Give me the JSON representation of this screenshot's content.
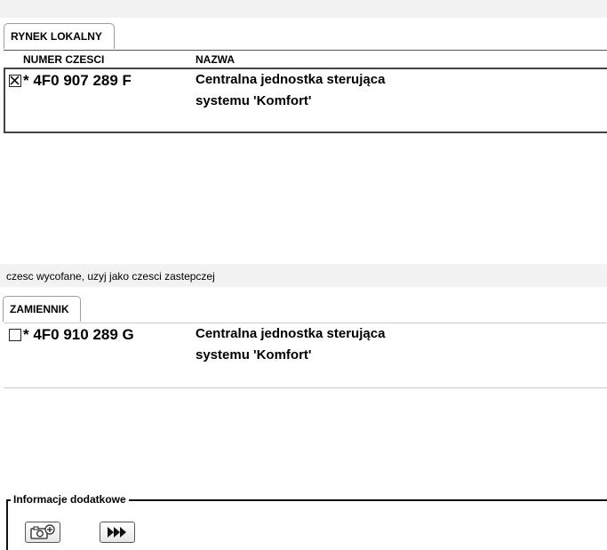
{
  "section1": {
    "tab_label": "RYNEK LOKALNY",
    "col_part_number": "NUMER CZESCI",
    "col_name": "NAZWA",
    "part": {
      "checked": true,
      "number": "* 4F0 907 289 F",
      "name_line1": "Centralna jednostka sterująca",
      "name_line2": "systemu 'Komfort'"
    }
  },
  "notice": "czesc wycofane, uzyj jako czesci zastepczej",
  "section2": {
    "tab_label": "ZAMIENNIK",
    "part": {
      "checked": false,
      "number": "* 4F0 910 289 G",
      "name_line1": "Centralna jednostka sterująca",
      "name_line2": "systemu 'Komfort'"
    }
  },
  "additional_info": {
    "legend": "Informacje dodatkowe",
    "buttons": [
      {
        "icon": "camera-plus-icon"
      },
      {
        "icon": "fast-forward-icon"
      }
    ]
  }
}
